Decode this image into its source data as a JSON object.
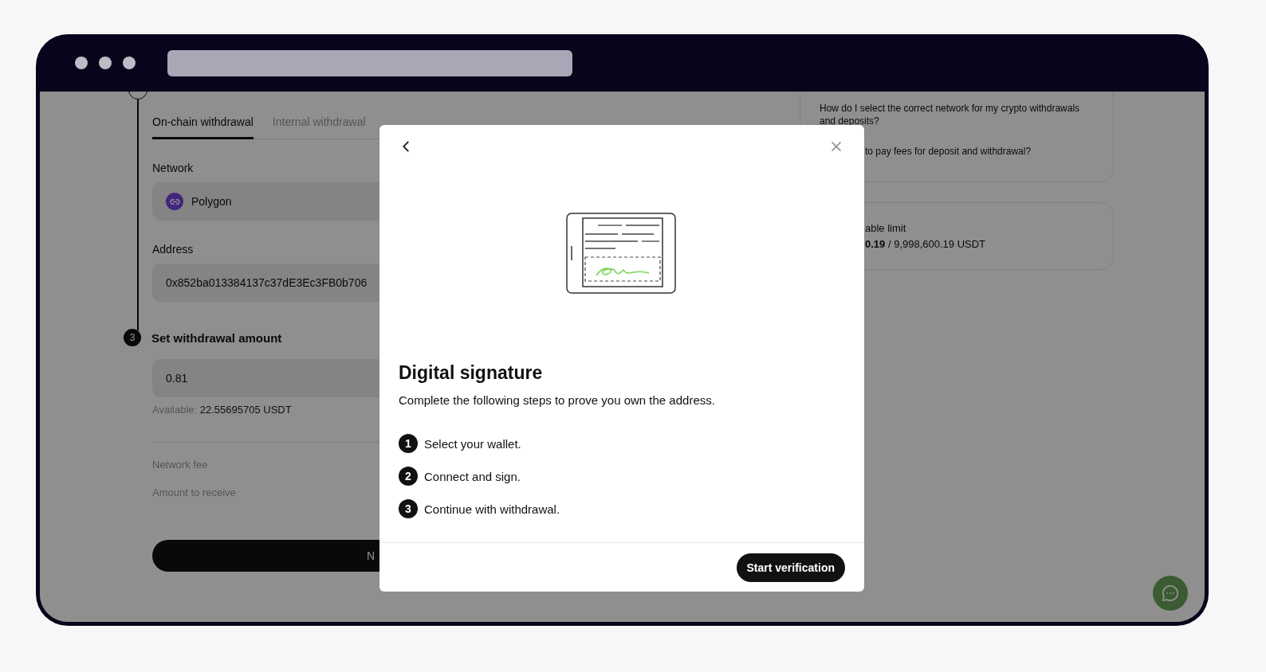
{
  "page": {
    "tabs": [
      {
        "label": "On-chain withdrawal",
        "selected": true
      },
      {
        "label": "Internal withdrawal",
        "selected": false
      }
    ],
    "network": {
      "label": "Network",
      "value": "Polygon"
    },
    "address": {
      "label": "Address",
      "value": "0x852ba013384137c37dE3Ec3FB0b706"
    },
    "amount_step": {
      "number": "3",
      "title": "Set withdrawal amount",
      "value": "0.81",
      "available_label": "Available:",
      "available_value": "22.55695705 USDT"
    },
    "summary": [
      "Network fee",
      "Amount to receive"
    ],
    "submit_button": "N",
    "faq": [
      "How do I select the correct network for my crypto withdrawals and deposits?",
      "to pay fees for deposit and withdrawal?"
    ],
    "limit": {
      "label": "able limit",
      "value": "**0.19** / 9,998,600.19 USDT"
    }
  },
  "modal": {
    "title": "Digital signature",
    "description": "Complete the following steps to prove you own the address.",
    "steps": [
      {
        "number": "1",
        "text": "Select your wallet."
      },
      {
        "number": "2",
        "text": "Connect and sign."
      },
      {
        "number": "3",
        "text": "Continue with withdrawal."
      }
    ],
    "button": "Start verification"
  }
}
